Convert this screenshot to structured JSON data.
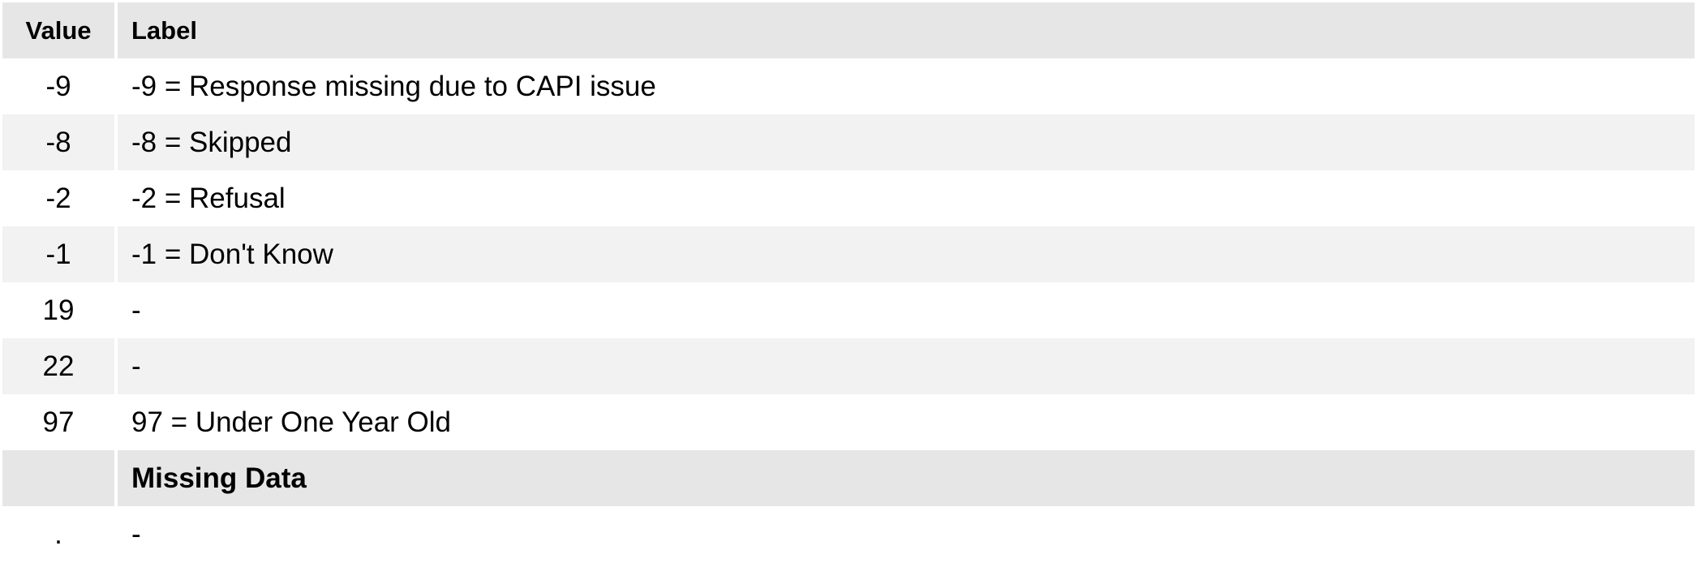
{
  "header": {
    "value": "Value",
    "label": "Label"
  },
  "rows": [
    {
      "value": "-9",
      "label": "-9 = Response missing due to CAPI issue"
    },
    {
      "value": "-8",
      "label": "-8 = Skipped"
    },
    {
      "value": "-2",
      "label": "-2 = Refusal"
    },
    {
      "value": "-1",
      "label": "-1 = Don't Know"
    },
    {
      "value": "19",
      "label": "-"
    },
    {
      "value": "22",
      "label": "-"
    },
    {
      "value": "97",
      "label": "97 = Under One Year Old"
    }
  ],
  "missing_section": {
    "value": "",
    "label": "Missing Data"
  },
  "missing_rows": [
    {
      "value": ".",
      "label": "-"
    }
  ],
  "colors": {
    "header_bg": "#e6e6e6",
    "stripe_bg": "#f2f2f2",
    "row_bg": "#ffffff"
  }
}
